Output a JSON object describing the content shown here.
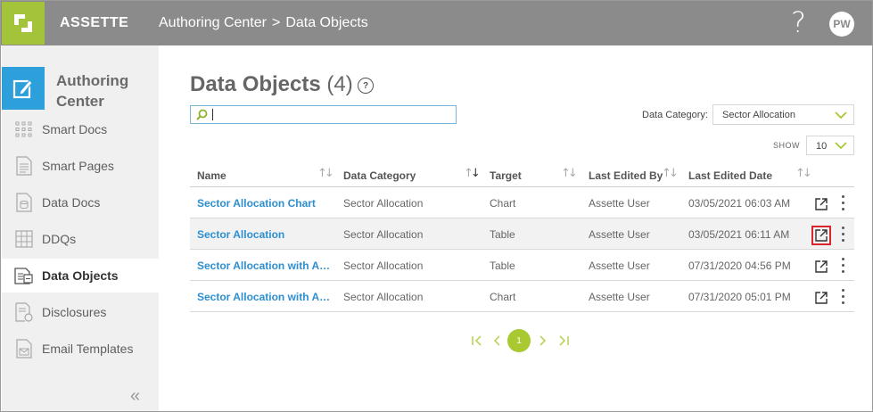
{
  "header": {
    "app_name": "ASSETTE",
    "breadcrumb": [
      "Authoring Center",
      "Data Objects"
    ],
    "breadcrumb_sep": ">",
    "help": "?",
    "avatar_initials": "PW"
  },
  "sidebar": {
    "title": "Authoring Center",
    "items": [
      {
        "label": "Smart Docs",
        "icon": "grid-dots-icon"
      },
      {
        "label": "Smart Pages",
        "icon": "page-icon"
      },
      {
        "label": "Data Docs",
        "icon": "data-doc-icon"
      },
      {
        "label": "DDQs",
        "icon": "ddq-table-icon"
      },
      {
        "label": "Data Objects",
        "icon": "data-objects-icon",
        "active": true
      },
      {
        "label": "Disclosures",
        "icon": "disclosure-icon"
      },
      {
        "label": "Email Templates",
        "icon": "email-template-icon"
      }
    ],
    "collapse": "«"
  },
  "main": {
    "title": "Data Objects",
    "count": "(4)",
    "title_help": "?",
    "search": {
      "value": "",
      "placeholder": ""
    },
    "category_label": "Data Category:",
    "category_value": "Sector Allocation",
    "show_label": "SHOW",
    "show_value": "10"
  },
  "table": {
    "columns": [
      "Name",
      "Data Category",
      "Target",
      "Last Edited By",
      "Last Edited Date"
    ],
    "rows": [
      {
        "name": "Sector Allocation Chart",
        "category": "Sector Allocation",
        "target": "Chart",
        "edited_by": "Assette User",
        "edited_date": "03/05/2021 06:03 AM"
      },
      {
        "name": "Sector Allocation",
        "category": "Sector Allocation",
        "target": "Table",
        "edited_by": "Assette User",
        "edited_date": "03/05/2021 06:11 AM"
      },
      {
        "name": "Sector Allocation with Att...",
        "category": "Sector Allocation",
        "target": "Table",
        "edited_by": "Assette User",
        "edited_date": "07/31/2020 04:56 PM"
      },
      {
        "name": "Sector Allocation with Att...",
        "category": "Sector Allocation",
        "target": "Chart",
        "edited_by": "Assette User",
        "edited_date": "07/31/2020 05:01 PM"
      }
    ]
  },
  "pagination": {
    "current_page": "1"
  },
  "colors": {
    "topbar": "#8b8b8b",
    "logo": "#a3c43a",
    "accent_blue": "#2d9fdb",
    "link": "#2d8fd0",
    "pager": "#a8c930",
    "highlight_box": "#d9262b"
  }
}
